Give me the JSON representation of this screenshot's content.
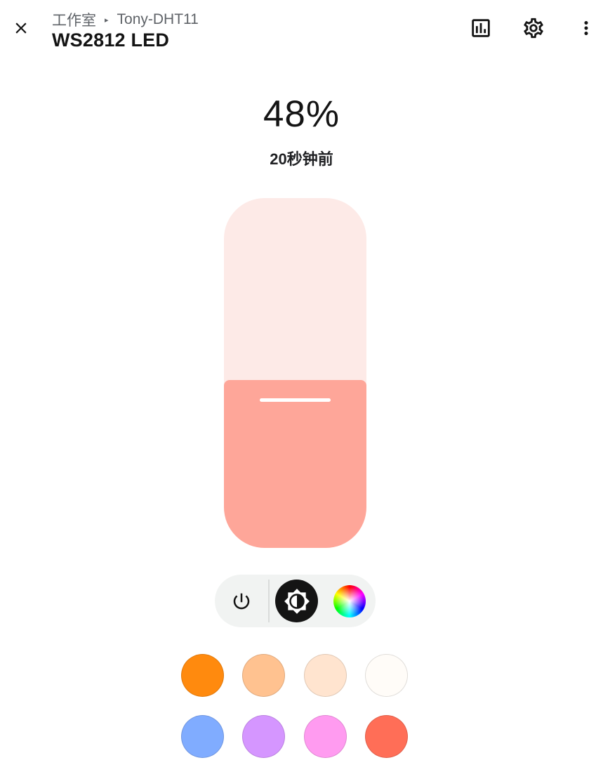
{
  "header": {
    "breadcrumb_area": "工作室",
    "breadcrumb_separator": "▸",
    "breadcrumb_device": "Tony-DHT11",
    "title": "WS2812 LED",
    "icons": [
      "close-icon",
      "chart-history-icon",
      "gear-icon",
      "more-vert-icon"
    ]
  },
  "state": {
    "brightness_label": "48%",
    "brightness_percent": 48,
    "last_changed": "20秒钟前"
  },
  "colors": {
    "slider_track": "#fdeae7",
    "slider_fill": "#fea699",
    "mode_bar": "#f1f3f2",
    "active_mode": "#141414"
  },
  "modes": [
    {
      "name": "power",
      "icon": "power-icon",
      "active": false
    },
    {
      "name": "brightness",
      "icon": "brightness-icon",
      "active": true
    },
    {
      "name": "color",
      "icon": "color-wheel-icon",
      "active": false
    }
  ],
  "favorite_colors": [
    "#ff8a0e",
    "#ffc290",
    "#ffe4cf",
    "#fffcf8",
    "#80acff",
    "#d596ff",
    "#ff9bf0",
    "#ff6e57"
  ]
}
